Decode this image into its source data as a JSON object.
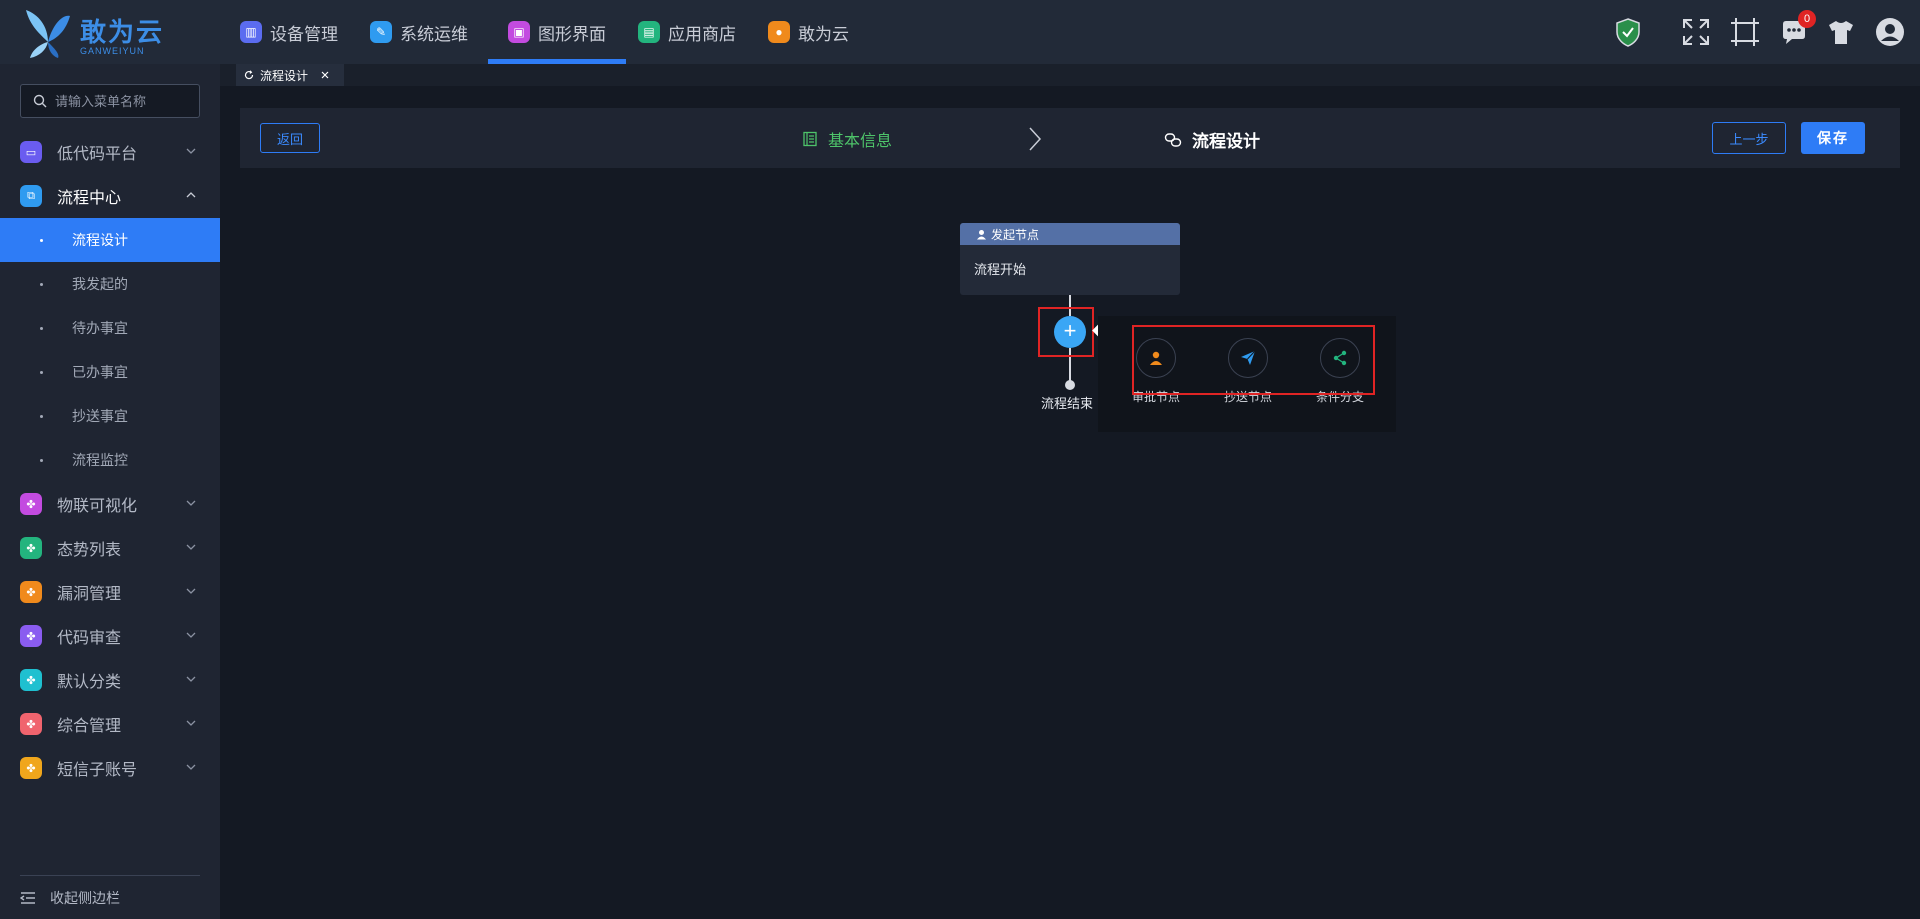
{
  "app": {
    "title": "敢为云",
    "subtitle": "GANWEIYUN"
  },
  "nav": [
    {
      "label": "设备管理",
      "color": "#5b6cf0"
    },
    {
      "label": "系统运维",
      "color": "#2f9bf0"
    },
    {
      "label": "图形界面",
      "color": "#c34be0",
      "active": true
    },
    {
      "label": "应用商店",
      "color": "#23b47e"
    },
    {
      "label": "敢为云",
      "color": "#f08a1c"
    }
  ],
  "top_icons": {
    "message_count": "0"
  },
  "sidebar": {
    "search_placeholder": "请输入菜单名称",
    "menu": [
      {
        "label": "低代码平台",
        "color": "#6a5cf0"
      },
      {
        "label": "流程中心",
        "color": "#2f9bf0"
      },
      {
        "label": "物联可视化",
        "color": "#c34be0"
      },
      {
        "label": "态势列表",
        "color": "#23b47e"
      },
      {
        "label": "漏洞管理",
        "color": "#f08a1c"
      },
      {
        "label": "代码审查",
        "color": "#8a5cf0"
      },
      {
        "label": "默认分类",
        "color": "#1fc0d0"
      },
      {
        "label": "综合管理",
        "color": "#f0646e"
      },
      {
        "label": "短信子账号",
        "color": "#f0a61c"
      }
    ],
    "sub_items": [
      "流程设计",
      "我发起的",
      "待办事宜",
      "已办事宜",
      "抄送事宜",
      "流程监控"
    ],
    "collapse_label": "收起侧边栏"
  },
  "tabs": [
    {
      "label": "流程设计"
    }
  ],
  "steps": {
    "back": "返回",
    "step1": "基本信息",
    "step2": "流程设计",
    "prev": "上一步",
    "save": "保存"
  },
  "flow": {
    "start_title": "发起节点",
    "start_body": "流程开始",
    "end_label": "流程结束",
    "options": [
      {
        "label": "审批节点",
        "color": "#f08a1c"
      },
      {
        "label": "抄送节点",
        "color": "#2f9bf0"
      },
      {
        "label": "条件分支",
        "color": "#23b47e"
      }
    ]
  }
}
